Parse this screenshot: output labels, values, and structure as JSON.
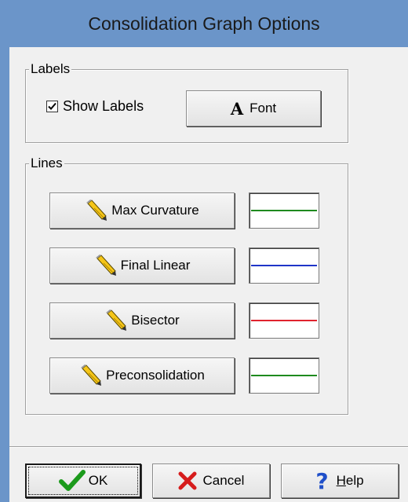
{
  "window": {
    "title": "Consolidation Graph Options"
  },
  "labels_group": {
    "legend": "Labels",
    "show_labels": {
      "label": "Show Labels",
      "checked": true
    },
    "font_button": {
      "label": "Font",
      "icon": "font-A-icon"
    }
  },
  "lines_group": {
    "legend": "Lines",
    "items": [
      {
        "label": "Max Curvature",
        "icon": "pencil-icon",
        "color": "#1e8a1e"
      },
      {
        "label": "Final Linear",
        "icon": "pencil-icon",
        "color": "#1f35c8"
      },
      {
        "label": "Bisector",
        "icon": "pencil-icon",
        "color": "#e0232e"
      },
      {
        "label": "Preconsolidation",
        "icon": "pencil-icon",
        "color": "#1e8a1e"
      }
    ]
  },
  "footer": {
    "ok": {
      "label": "OK",
      "icon": "check-icon"
    },
    "cancel": {
      "label": "Cancel",
      "icon": "x-icon"
    },
    "help": {
      "label": "Help",
      "mnemonic": "H",
      "rest": "elp",
      "icon": "question-icon"
    }
  },
  "colors": {
    "title_bar": "#6b95c9",
    "dialog_bg": "#f0f0f0"
  }
}
